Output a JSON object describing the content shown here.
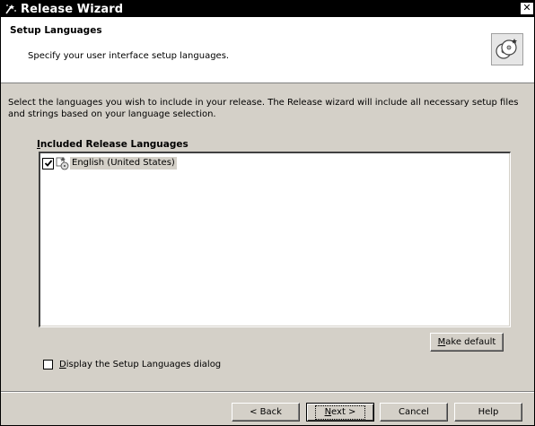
{
  "window": {
    "title": "Release Wizard",
    "close_glyph": "✕"
  },
  "header": {
    "title": "Setup Languages",
    "subtitle": "Specify your user interface setup languages."
  },
  "description": "Select the languages you wish to include in your release. The Release wizard will include all necessary setup files and strings based on your language selection.",
  "languages": {
    "group_label_mnemonic": "I",
    "group_label_rest": "ncluded Release Languages",
    "items": [
      {
        "label": "English (United States)",
        "checked": true,
        "icon": "language-setup-icon"
      }
    ]
  },
  "buttons": {
    "make_default_mnemonic": "M",
    "make_default_rest": "ake default",
    "back": "< Back",
    "next_mnemonic": "N",
    "next_rest": "ext >",
    "cancel": "Cancel",
    "help": "Help"
  },
  "display_dialog": {
    "checked": false,
    "label_mnemonic": "D",
    "label_rest": "isplay the Setup Languages dialog"
  },
  "colors": {
    "titlebar_bg": "#000000",
    "dialog_bg": "#d4d0c8",
    "header_bg": "#ffffff",
    "selection_bg": "#d4d0c8"
  },
  "icons": {
    "title": "wizard-icon",
    "header": "cd-disc-icon",
    "close": "close-icon"
  }
}
